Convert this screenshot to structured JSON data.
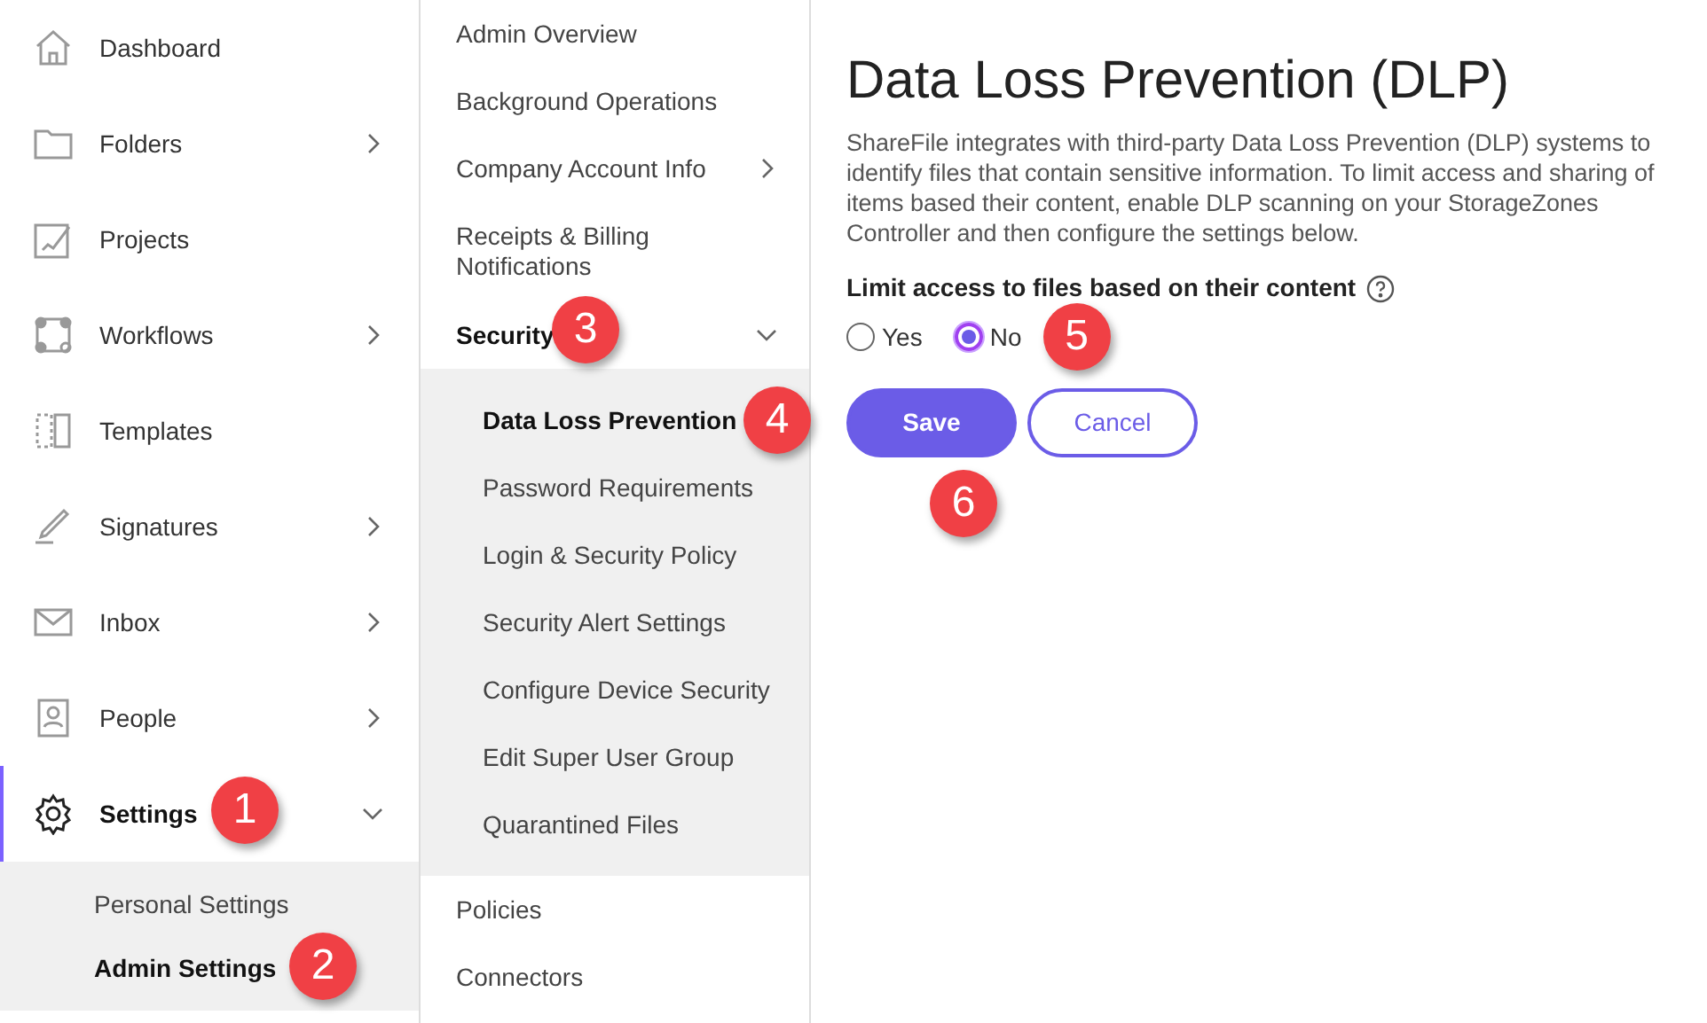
{
  "main_nav": [
    {
      "label": "Dashboard",
      "selected": false
    },
    {
      "label": "Folders",
      "expanded": false,
      "selected": false
    },
    {
      "label": "Projects",
      "selected": false
    },
    {
      "label": "Workflows",
      "expanded": false,
      "selected": false
    },
    {
      "label": "Templates",
      "selected": false
    },
    {
      "label": "Signatures",
      "expanded": false,
      "selected": false
    },
    {
      "label": "Inbox",
      "expanded": false,
      "selected": false
    },
    {
      "label": "People",
      "expanded": false,
      "selected": false
    },
    {
      "label": "Settings",
      "expanded": true,
      "selected": true,
      "callout": "1",
      "children": [
        {
          "label": "Personal Settings",
          "selected": false
        },
        {
          "label": "Admin Settings",
          "selected": true,
          "callout": "2"
        }
      ]
    }
  ],
  "admin_nav": [
    {
      "label": "Admin Overview",
      "selected": false
    },
    {
      "label": "Background Operations",
      "selected": false
    },
    {
      "label": "Company Account Info",
      "expanded": false,
      "selected": false
    },
    {
      "label": "Receipts & Billing Notifications",
      "selected": false
    },
    {
      "label": "Security",
      "expanded": true,
      "selected": true,
      "callout": "3",
      "children": [
        {
          "label": "Data Loss Prevention",
          "selected": true,
          "callout": "4"
        },
        {
          "label": "Password Requirements",
          "selected": false
        },
        {
          "label": "Login & Security Policy",
          "selected": false
        },
        {
          "label": "Security Alert Settings",
          "selected": false
        },
        {
          "label": "Configure Device Security",
          "selected": false
        },
        {
          "label": "Edit Super User Group",
          "selected": false
        },
        {
          "label": "Quarantined Files",
          "selected": false
        }
      ]
    },
    {
      "label": "Policies",
      "selected": false
    },
    {
      "label": "Connectors",
      "selected": false
    }
  ],
  "page": {
    "title": "Data Loss Prevention (DLP)",
    "description": "ShareFile integrates with third-party Data Loss Prevention (DLP) systems to identify files that contain sensitive information. To limit access and sharing of items based their content, enable DLP scanning on your StorageZones Controller and then configure the settings below.",
    "setting_label": "Limit access to files based on their content",
    "options": [
      {
        "label": "Yes",
        "selected": false
      },
      {
        "label": "No",
        "selected": true,
        "callout": "5"
      }
    ],
    "buttons": [
      {
        "label": "Save",
        "kind": "primary",
        "callout": "6"
      },
      {
        "label": "Cancel",
        "kind": "secondary"
      }
    ]
  }
}
